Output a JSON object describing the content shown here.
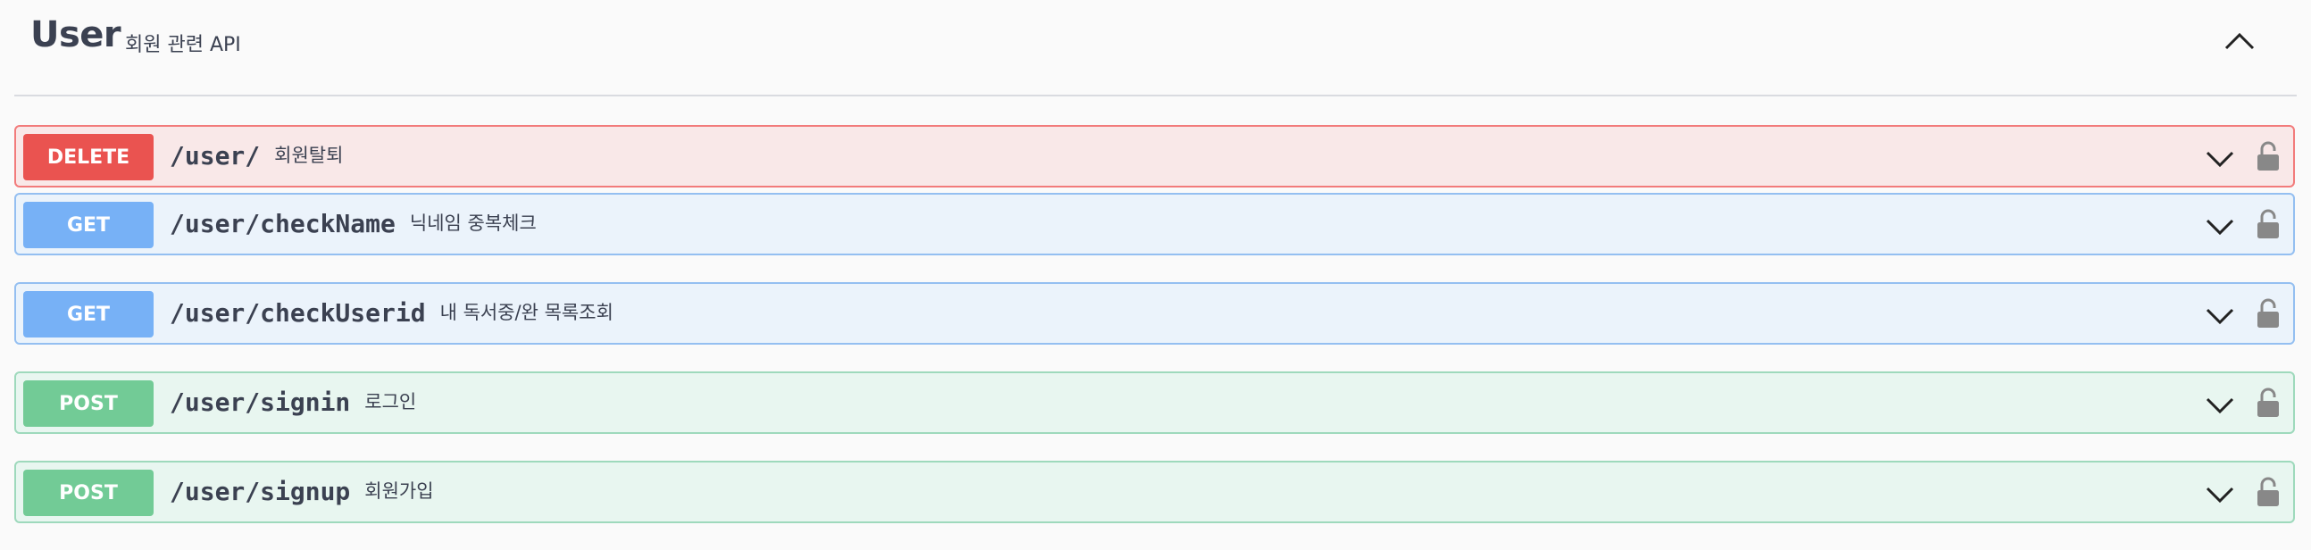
{
  "tag": {
    "name": "User",
    "description": "회원 관련 API",
    "collapse_icon": "chevron-up-icon"
  },
  "operations": [
    {
      "method": "DELETE",
      "path": "/user/",
      "summary": "회원탈퇴",
      "color": "#ea5350"
    },
    {
      "method": "GET",
      "path": "/user/checkName",
      "summary": "닉네임 중복체크",
      "color": "#77b1f6"
    },
    {
      "method": "GET",
      "path": "/user/checkUserid",
      "summary": "내 독서중/완 목록조회",
      "color": "#77b1f6"
    },
    {
      "method": "POST",
      "path": "/user/signin",
      "summary": "로그인",
      "color": "#72cb96"
    },
    {
      "method": "POST",
      "path": "/user/signup",
      "summary": "회원가입",
      "color": "#72cb96"
    }
  ],
  "icons": {
    "expand": "chevron-down-icon",
    "auth": "unlocked-icon"
  }
}
